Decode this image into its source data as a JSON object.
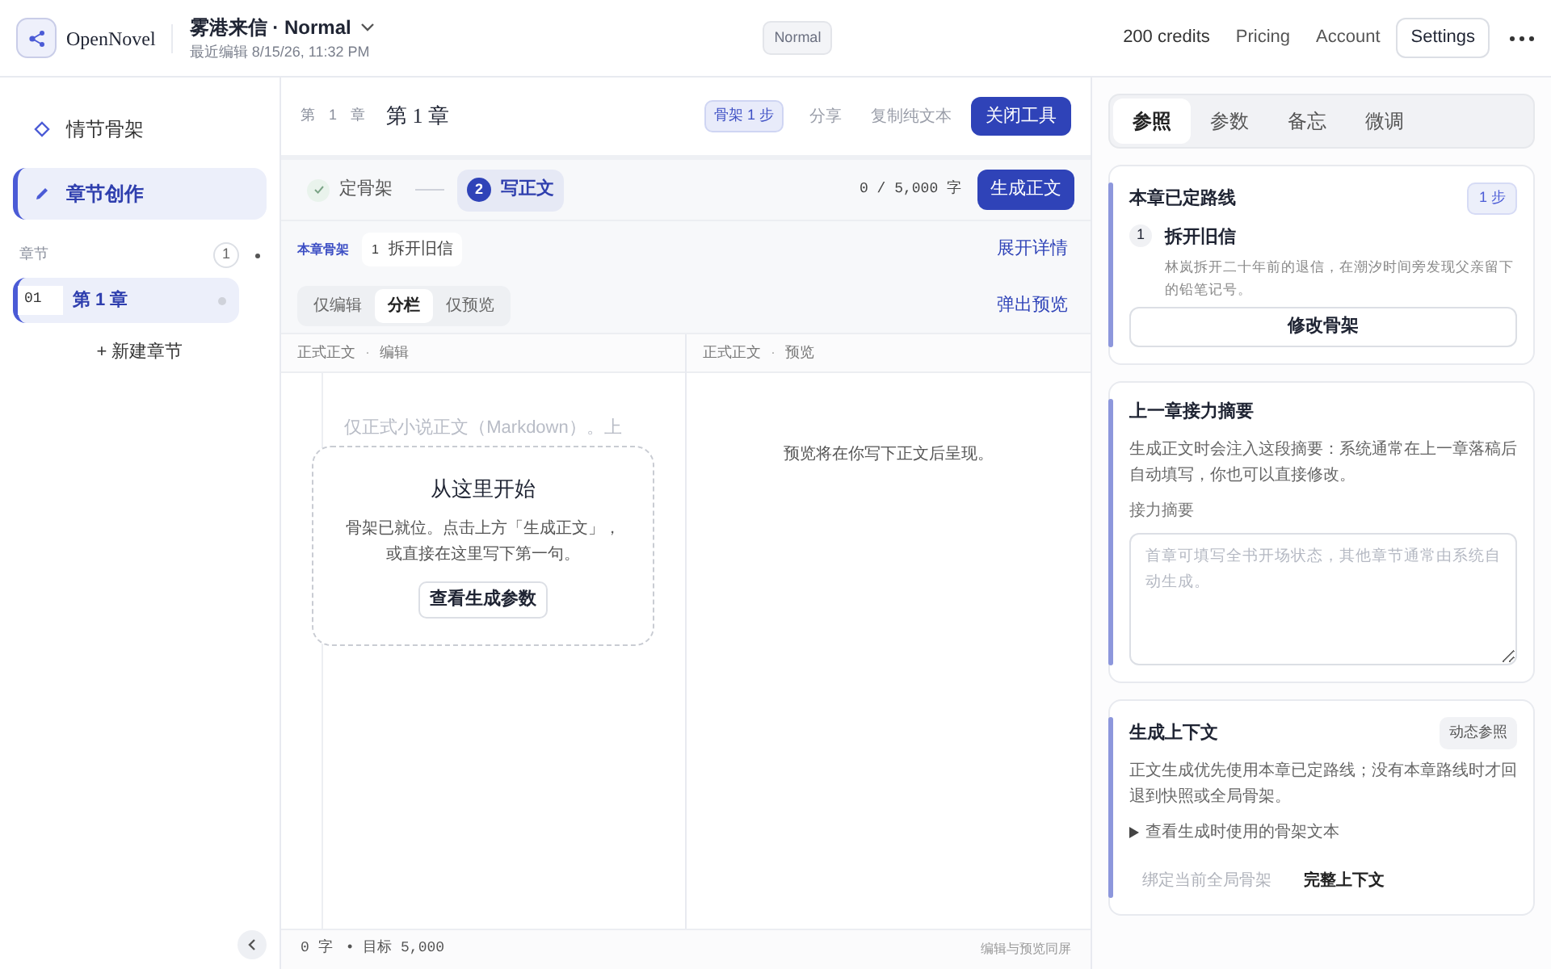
{
  "header": {
    "logo": "OpenNovel",
    "title": "雾港来信 · Normal",
    "subtitle": "最近编辑 8/15/26, 11:32 PM",
    "mode_badge": "Normal",
    "credits": "200 credits",
    "links": [
      "Pricing",
      "Account"
    ],
    "settings": "Settings"
  },
  "sidebar": {
    "nav": [
      {
        "label": "情节骨架",
        "selected": false,
        "kind": "diamond"
      },
      {
        "label": "章节创作",
        "selected": true,
        "kind": "pen"
      }
    ],
    "section_label": "章节",
    "chapter_count": "1",
    "chapters": [
      {
        "number": "01",
        "title": "第 1 章",
        "selected": true
      }
    ],
    "new_chapter": "+ 新建章节"
  },
  "editor": {
    "chapter_label": "第 1 章",
    "chapter_title": "第 1 章",
    "skeleton_badge": "骨架 1 步",
    "actions": [
      "分享",
      "复制纯文本"
    ],
    "close_tools": "关闭工具",
    "steps": [
      {
        "label": "定骨架",
        "done": true,
        "selected": false
      },
      {
        "number": "2",
        "label": "写正文",
        "done": false,
        "selected": true
      }
    ],
    "word_count": "0 / 5,000 字",
    "generate": "生成正文",
    "skeleton_label": "本章骨架",
    "skeleton_chip": {
      "number": "1",
      "label": "拆开旧信"
    },
    "expand": "展开详情",
    "view_modes": [
      {
        "label": "仅编辑",
        "selected": false
      },
      {
        "label": "分栏",
        "selected": true
      },
      {
        "label": "仅预览",
        "selected": false
      }
    ],
    "popout": "弹出预览",
    "columns": [
      {
        "label": "正式正文",
        "separator": "·",
        "mode": "编辑"
      },
      {
        "label": "正式正文",
        "separator": "·",
        "mode": "预览"
      }
    ],
    "placeholder": "仅正式小说正文（Markdown）。上",
    "start_card": {
      "title": "从这里开始",
      "body": "骨架已就位。点击上方「生成正文」，或直接在这里写下第一句。",
      "button": "查看生成参数"
    },
    "preview_placeholder": "预览将在你写下正文后呈现。",
    "footer": {
      "count": "0 字",
      "target": "• 目标 5,000",
      "mode": "编辑与预览同屏"
    }
  },
  "panel": {
    "tabs": [
      {
        "label": "参照",
        "selected": true
      },
      {
        "label": "参数",
        "selected": false
      },
      {
        "label": "备忘",
        "selected": false
      },
      {
        "label": "微调",
        "selected": false
      }
    ],
    "route_card": {
      "title": "本章已定路线",
      "badge": "1 步",
      "steps": [
        {
          "number": "1",
          "title": "拆开旧信",
          "description": "林岚拆开二十年前的退信，在潮汐时间旁发现父亲留下的铅笔记号。"
        }
      ],
      "button": "修改骨架"
    },
    "summary_card": {
      "title": "上一章接力摘要",
      "description": "生成正文时会注入这段摘要：系统通常在上一章落稿后自动填写，你也可以直接修改。",
      "field_label": "接力摘要",
      "placeholder": "首章可填写全书开场状态，其他章节通常由系统自动生成。"
    },
    "context_card": {
      "title": "生成上下文",
      "badge": "动态参照",
      "description": "正文生成优先使用本章已定路线；没有本章路线时才回退到快照或全局骨架。",
      "disclosure": {
        "label": "查看生成时使用的骨架文本",
        "expanded": false
      },
      "buttons": [
        {
          "label": "绑定当前全局骨架",
          "disabled": true
        },
        {
          "label": "完整上下文",
          "disabled": false
        }
      ]
    }
  }
}
